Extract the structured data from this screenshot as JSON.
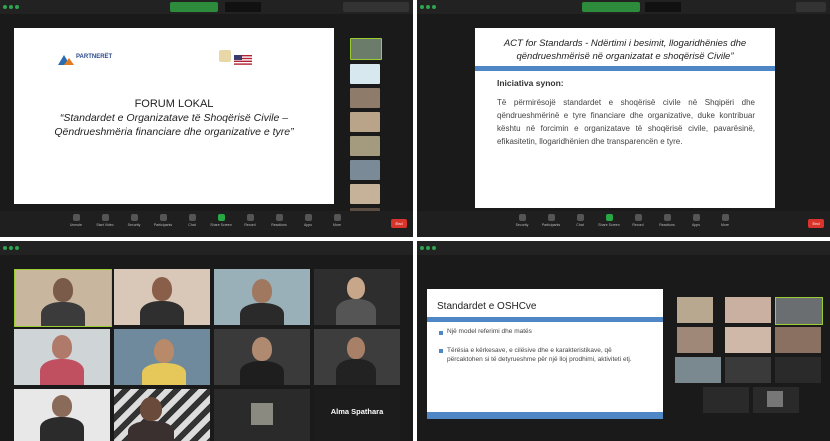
{
  "toolbar": {
    "items": [
      "Unmute",
      "Start Video",
      "Security",
      "Participants",
      "Chat",
      "Share Screen",
      "Record",
      "Reactions",
      "Apps",
      "More"
    ],
    "end_label": "End"
  },
  "panels": {
    "top_left": {
      "slide": {
        "logo_text": "PARTNERËT",
        "heading": "FORUM LOKAL",
        "subtitle_line1": "“Standardet e Organizatave të Shoqërisë Civile –",
        "subtitle_line2": "Qëndrueshmëria financiare dhe organizative e tyre”"
      }
    },
    "top_right": {
      "slide": {
        "title_line1": "ACT for Standards - Ndërtimi i besimit, llogaridhënies dhe",
        "title_line2": "qëndrueshmërisë në organizatat e shoqërisë Civile”",
        "subheading": "Iniciativa synon:",
        "body": "Të përmirësojë standardet e shoqërisë civile në Shqipëri dhe qëndrueshmërinë e tyre financiare dhe organizative, duke kontribuar kështu në forcimin e organizatave të shoqërisë civile, pavarësinë, efikasitetin, llogaridhënien dhe transparencën e tyre."
      }
    },
    "bottom_left": {
      "named_tile": "Alma Spathara"
    },
    "bottom_right": {
      "slide": {
        "title": "Standardet e OSHCve",
        "bullet1": "Një model referimi dhe matës",
        "bullet2": "Tërësia e kërkesave, e cilësive dhe e karakteristikave, që përcaktohen si të detyrueshme për një lloj prodhimi, aktiviteti etj."
      }
    }
  },
  "colors": {
    "slide_blue_bar": "#4f86c6",
    "zoom_green": "#2d8c3c",
    "end_red": "#d9342b"
  }
}
